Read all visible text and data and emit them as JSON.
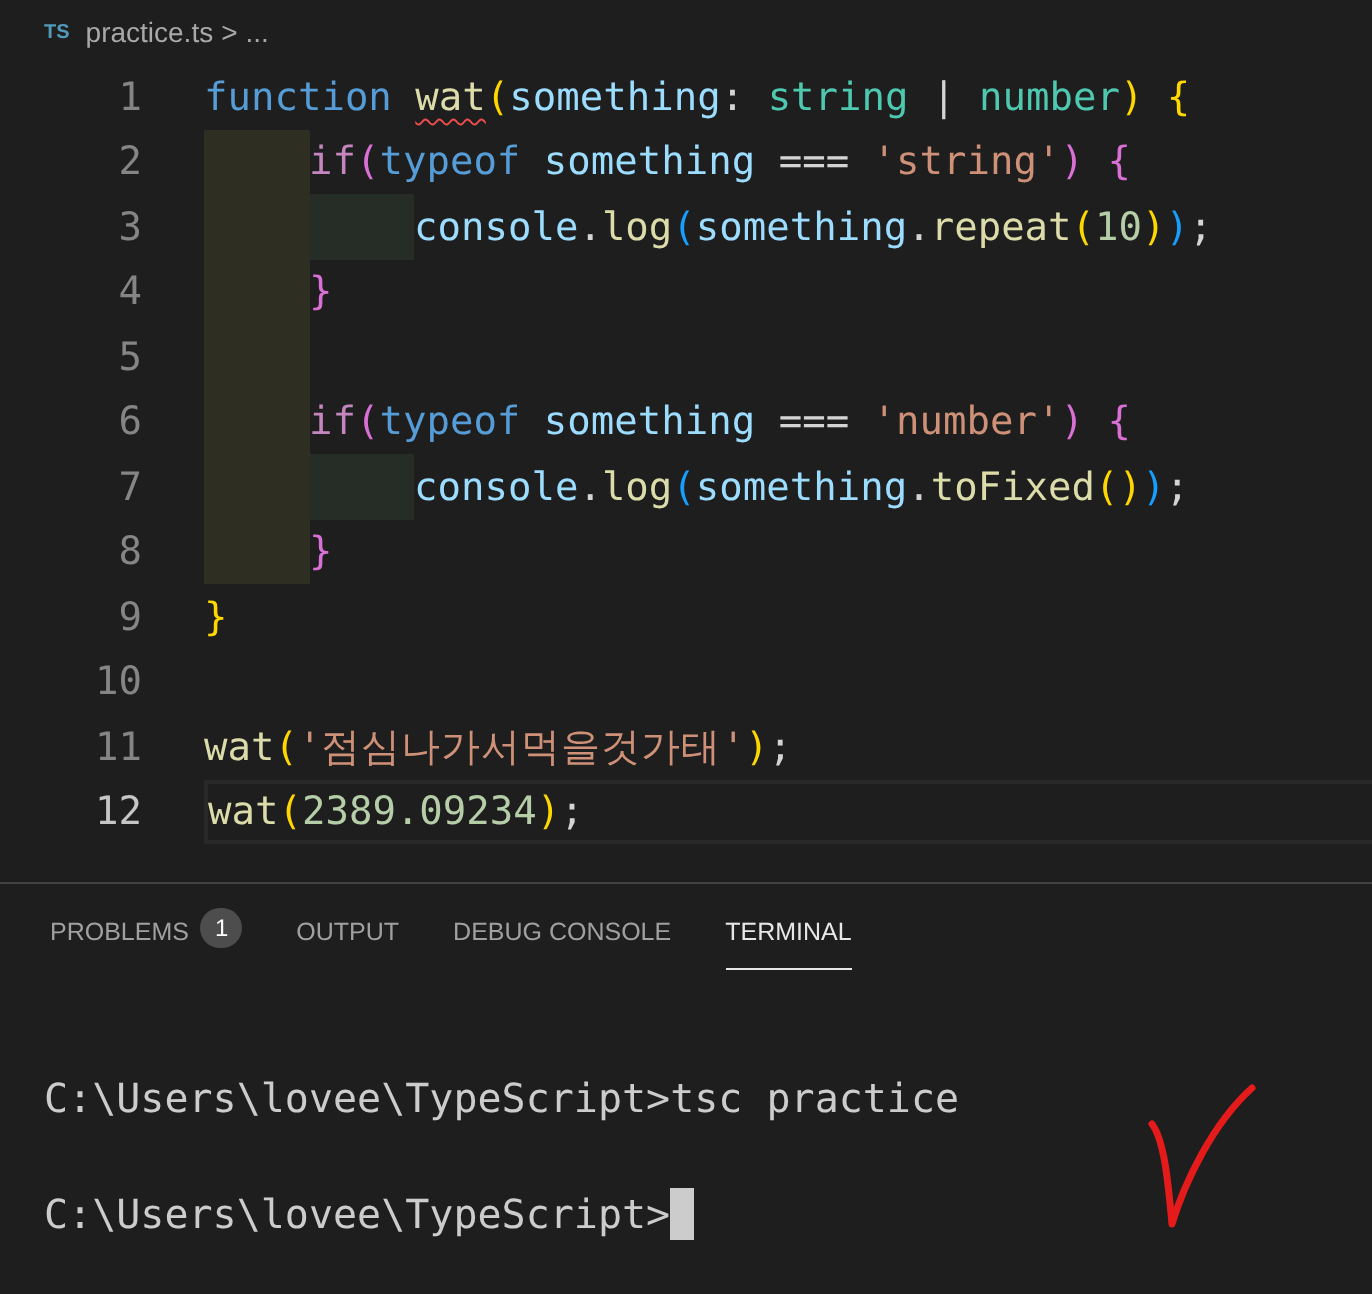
{
  "breadcrumb": {
    "file_icon": "TS",
    "file": "practice.ts",
    "separator": ">",
    "more": "..."
  },
  "editor": {
    "lines": [
      {
        "number": "1",
        "current": false,
        "outer_guide": false,
        "inner_guide": false,
        "tokens": [
          {
            "text": "function ",
            "kind": "keyword"
          },
          {
            "text": "wat",
            "kind": "function",
            "error": true
          },
          {
            "text": "(",
            "kind": "bracket1"
          },
          {
            "text": "something",
            "kind": "variable"
          },
          {
            "text": ": ",
            "kind": "plain"
          },
          {
            "text": "string",
            "kind": "type"
          },
          {
            "text": " | ",
            "kind": "plain"
          },
          {
            "text": "number",
            "kind": "type"
          },
          {
            "text": ") {",
            "kind": "bracket1"
          }
        ]
      },
      {
        "number": "2",
        "current": false,
        "outer_guide": true,
        "inner_guide": false,
        "tokens": [
          {
            "text": "if",
            "kind": "control"
          },
          {
            "text": "(",
            "kind": "bracket2"
          },
          {
            "text": "typeof ",
            "kind": "keyword"
          },
          {
            "text": "something",
            "kind": "variable"
          },
          {
            "text": " === ",
            "kind": "plain"
          },
          {
            "text": "'string'",
            "kind": "string"
          },
          {
            "text": ") {",
            "kind": "bracket2"
          }
        ]
      },
      {
        "number": "3",
        "current": false,
        "outer_guide": true,
        "inner_guide": true,
        "tokens": [
          {
            "text": "console",
            "kind": "variable"
          },
          {
            "text": ".",
            "kind": "plain"
          },
          {
            "text": "log",
            "kind": "function"
          },
          {
            "text": "(",
            "kind": "bracket3"
          },
          {
            "text": "something",
            "kind": "variable"
          },
          {
            "text": ".",
            "kind": "plain"
          },
          {
            "text": "repeat",
            "kind": "function"
          },
          {
            "text": "(",
            "kind": "bracket1"
          },
          {
            "text": "10",
            "kind": "number"
          },
          {
            "text": ")",
            "kind": "bracket1"
          },
          {
            "text": ")",
            "kind": "bracket3"
          },
          {
            "text": ";",
            "kind": "plain"
          }
        ]
      },
      {
        "number": "4",
        "current": false,
        "outer_guide": true,
        "inner_guide": false,
        "tokens": [
          {
            "text": "}",
            "kind": "bracket2"
          }
        ]
      },
      {
        "number": "5",
        "current": false,
        "outer_guide": true,
        "inner_guide": false
      },
      {
        "number": "6",
        "current": false,
        "outer_guide": true,
        "inner_guide": false,
        "tokens": [
          {
            "text": "if",
            "kind": "control"
          },
          {
            "text": "(",
            "kind": "bracket2"
          },
          {
            "text": "typeof ",
            "kind": "keyword"
          },
          {
            "text": "something",
            "kind": "variable"
          },
          {
            "text": " === ",
            "kind": "plain"
          },
          {
            "text": "'number'",
            "kind": "string"
          },
          {
            "text": ") {",
            "kind": "bracket2"
          }
        ]
      },
      {
        "number": "7",
        "current": false,
        "outer_guide": true,
        "inner_guide": true,
        "tokens": [
          {
            "text": "console",
            "kind": "variable"
          },
          {
            "text": ".",
            "kind": "plain"
          },
          {
            "text": "log",
            "kind": "function"
          },
          {
            "text": "(",
            "kind": "bracket3"
          },
          {
            "text": "something",
            "kind": "variable"
          },
          {
            "text": ".",
            "kind": "plain"
          },
          {
            "text": "toFixed",
            "kind": "function"
          },
          {
            "text": "()",
            "kind": "bracket1"
          },
          {
            "text": ")",
            "kind": "bracket3"
          },
          {
            "text": ";",
            "kind": "plain"
          }
        ]
      },
      {
        "number": "8",
        "current": false,
        "outer_guide": true,
        "inner_guide": false,
        "tokens": [
          {
            "text": "}",
            "kind": "bracket2"
          }
        ]
      },
      {
        "number": "9",
        "current": false,
        "outer_guide": false,
        "inner_guide": false,
        "tokens": [
          {
            "text": "}",
            "kind": "bracket1"
          }
        ]
      },
      {
        "number": "10",
        "current": false,
        "outer_guide": false,
        "inner_guide": false
      },
      {
        "number": "11",
        "current": false,
        "outer_guide": false,
        "inner_guide": false,
        "tokens": [
          {
            "text": "wat",
            "kind": "function"
          },
          {
            "text": "(",
            "kind": "bracket1"
          },
          {
            "text": "'점심나가서먹을것가태'",
            "kind": "string"
          },
          {
            "text": ")",
            "kind": "bracket1"
          },
          {
            "text": ";",
            "kind": "plain"
          }
        ]
      },
      {
        "number": "12",
        "current": true,
        "outer_guide": false,
        "inner_guide": false,
        "tokens": [
          {
            "text": "wat",
            "kind": "function"
          },
          {
            "text": "(",
            "kind": "bracket1"
          },
          {
            "text": "2389.09234",
            "kind": "number"
          },
          {
            "text": ")",
            "kind": "bracket1"
          },
          {
            "text": ";",
            "kind": "plain"
          }
        ]
      }
    ]
  },
  "panel": {
    "tabs": [
      {
        "label": "PROBLEMS",
        "badge": "1",
        "selected": false
      },
      {
        "label": "OUTPUT",
        "selected": false
      },
      {
        "label": "DEBUG CONSOLE",
        "selected": false
      },
      {
        "label": "TERMINAL",
        "selected": true
      }
    ],
    "terminal": [
      {
        "text": "C:\\Users\\lovee\\TypeScript>tsc practice",
        "cursor": false
      },
      {
        "text": "C:\\Users\\lovee\\TypeScript>",
        "cursor": true
      }
    ]
  }
}
